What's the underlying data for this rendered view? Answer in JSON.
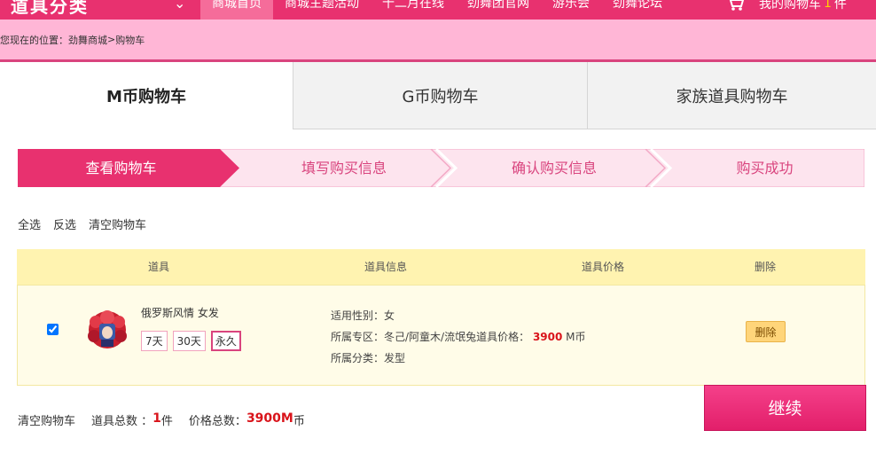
{
  "topnav": {
    "logo": "道具分类",
    "items": [
      "商城首页",
      "商城主题活动",
      "十二月在线",
      "劲舞团官网",
      "游乐会",
      "劲舞论坛"
    ],
    "cart_prefix": "我的购物车",
    "cart_count": "1",
    "cart_suffix": "件"
  },
  "breadcrumb": {
    "prefix": "您现在的位置：",
    "path": "劲舞商城",
    "sep": ">",
    "current": "购物车"
  },
  "tabs": [
    "M币购物车",
    "G币购物车",
    "家族道具购物车"
  ],
  "steps": [
    "查看购物车",
    "填写购买信息",
    "确认购买信息",
    "购买成功"
  ],
  "actions": {
    "select_all": "全选",
    "invert": "反选",
    "clear": "清空购物车"
  },
  "table": {
    "headers": [
      "道具",
      "道具信息",
      "道具价格",
      "删除"
    ],
    "row": {
      "checked": true,
      "name": "俄罗斯风情 女发",
      "durations": [
        "7天",
        "30天",
        "永久"
      ],
      "selected_duration": "永久",
      "gender_label": "适用性别：",
      "gender": "女",
      "zone_label": "所属专区：",
      "zone": "冬己/阿童木/流氓兔道具价格：",
      "price": "3900",
      "currency": "M币",
      "category_label": "所属分类：",
      "category": "发型",
      "delete_label": "删除"
    }
  },
  "summary": {
    "clear": "清空购物车",
    "count_label": "道具总数 ：",
    "count": "1",
    "count_unit": "件",
    "total_label": "价格总数：",
    "total": "3900M",
    "total_unit": "币"
  },
  "continue_label": "继续",
  "colors": {
    "brand": "#e8316f",
    "breadcrumb_bg": "#ffb6d6",
    "table_header": "#fff3b0",
    "price_red": "#d9141b"
  }
}
